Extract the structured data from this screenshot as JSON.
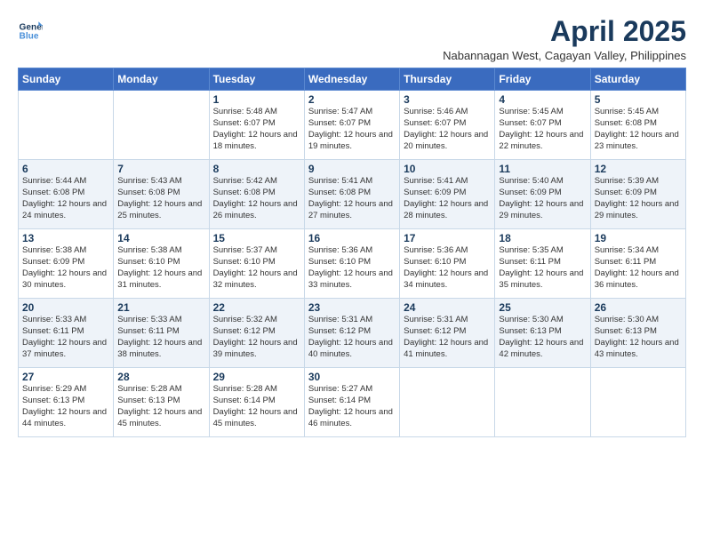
{
  "logo": {
    "line1": "General",
    "line2": "Blue"
  },
  "title": "April 2025",
  "subtitle": "Nabannagan West, Cagayan Valley, Philippines",
  "days_of_week": [
    "Sunday",
    "Monday",
    "Tuesday",
    "Wednesday",
    "Thursday",
    "Friday",
    "Saturday"
  ],
  "weeks": [
    [
      {
        "day": "",
        "info": ""
      },
      {
        "day": "",
        "info": ""
      },
      {
        "day": "1",
        "info": "Sunrise: 5:48 AM\nSunset: 6:07 PM\nDaylight: 12 hours and 18 minutes."
      },
      {
        "day": "2",
        "info": "Sunrise: 5:47 AM\nSunset: 6:07 PM\nDaylight: 12 hours and 19 minutes."
      },
      {
        "day": "3",
        "info": "Sunrise: 5:46 AM\nSunset: 6:07 PM\nDaylight: 12 hours and 20 minutes."
      },
      {
        "day": "4",
        "info": "Sunrise: 5:45 AM\nSunset: 6:07 PM\nDaylight: 12 hours and 22 minutes."
      },
      {
        "day": "5",
        "info": "Sunrise: 5:45 AM\nSunset: 6:08 PM\nDaylight: 12 hours and 23 minutes."
      }
    ],
    [
      {
        "day": "6",
        "info": "Sunrise: 5:44 AM\nSunset: 6:08 PM\nDaylight: 12 hours and 24 minutes."
      },
      {
        "day": "7",
        "info": "Sunrise: 5:43 AM\nSunset: 6:08 PM\nDaylight: 12 hours and 25 minutes."
      },
      {
        "day": "8",
        "info": "Sunrise: 5:42 AM\nSunset: 6:08 PM\nDaylight: 12 hours and 26 minutes."
      },
      {
        "day": "9",
        "info": "Sunrise: 5:41 AM\nSunset: 6:08 PM\nDaylight: 12 hours and 27 minutes."
      },
      {
        "day": "10",
        "info": "Sunrise: 5:41 AM\nSunset: 6:09 PM\nDaylight: 12 hours and 28 minutes."
      },
      {
        "day": "11",
        "info": "Sunrise: 5:40 AM\nSunset: 6:09 PM\nDaylight: 12 hours and 29 minutes."
      },
      {
        "day": "12",
        "info": "Sunrise: 5:39 AM\nSunset: 6:09 PM\nDaylight: 12 hours and 29 minutes."
      }
    ],
    [
      {
        "day": "13",
        "info": "Sunrise: 5:38 AM\nSunset: 6:09 PM\nDaylight: 12 hours and 30 minutes."
      },
      {
        "day": "14",
        "info": "Sunrise: 5:38 AM\nSunset: 6:10 PM\nDaylight: 12 hours and 31 minutes."
      },
      {
        "day": "15",
        "info": "Sunrise: 5:37 AM\nSunset: 6:10 PM\nDaylight: 12 hours and 32 minutes."
      },
      {
        "day": "16",
        "info": "Sunrise: 5:36 AM\nSunset: 6:10 PM\nDaylight: 12 hours and 33 minutes."
      },
      {
        "day": "17",
        "info": "Sunrise: 5:36 AM\nSunset: 6:10 PM\nDaylight: 12 hours and 34 minutes."
      },
      {
        "day": "18",
        "info": "Sunrise: 5:35 AM\nSunset: 6:11 PM\nDaylight: 12 hours and 35 minutes."
      },
      {
        "day": "19",
        "info": "Sunrise: 5:34 AM\nSunset: 6:11 PM\nDaylight: 12 hours and 36 minutes."
      }
    ],
    [
      {
        "day": "20",
        "info": "Sunrise: 5:33 AM\nSunset: 6:11 PM\nDaylight: 12 hours and 37 minutes."
      },
      {
        "day": "21",
        "info": "Sunrise: 5:33 AM\nSunset: 6:11 PM\nDaylight: 12 hours and 38 minutes."
      },
      {
        "day": "22",
        "info": "Sunrise: 5:32 AM\nSunset: 6:12 PM\nDaylight: 12 hours and 39 minutes."
      },
      {
        "day": "23",
        "info": "Sunrise: 5:31 AM\nSunset: 6:12 PM\nDaylight: 12 hours and 40 minutes."
      },
      {
        "day": "24",
        "info": "Sunrise: 5:31 AM\nSunset: 6:12 PM\nDaylight: 12 hours and 41 minutes."
      },
      {
        "day": "25",
        "info": "Sunrise: 5:30 AM\nSunset: 6:13 PM\nDaylight: 12 hours and 42 minutes."
      },
      {
        "day": "26",
        "info": "Sunrise: 5:30 AM\nSunset: 6:13 PM\nDaylight: 12 hours and 43 minutes."
      }
    ],
    [
      {
        "day": "27",
        "info": "Sunrise: 5:29 AM\nSunset: 6:13 PM\nDaylight: 12 hours and 44 minutes."
      },
      {
        "day": "28",
        "info": "Sunrise: 5:28 AM\nSunset: 6:13 PM\nDaylight: 12 hours and 45 minutes."
      },
      {
        "day": "29",
        "info": "Sunrise: 5:28 AM\nSunset: 6:14 PM\nDaylight: 12 hours and 45 minutes."
      },
      {
        "day": "30",
        "info": "Sunrise: 5:27 AM\nSunset: 6:14 PM\nDaylight: 12 hours and 46 minutes."
      },
      {
        "day": "",
        "info": ""
      },
      {
        "day": "",
        "info": ""
      },
      {
        "day": "",
        "info": ""
      }
    ]
  ]
}
